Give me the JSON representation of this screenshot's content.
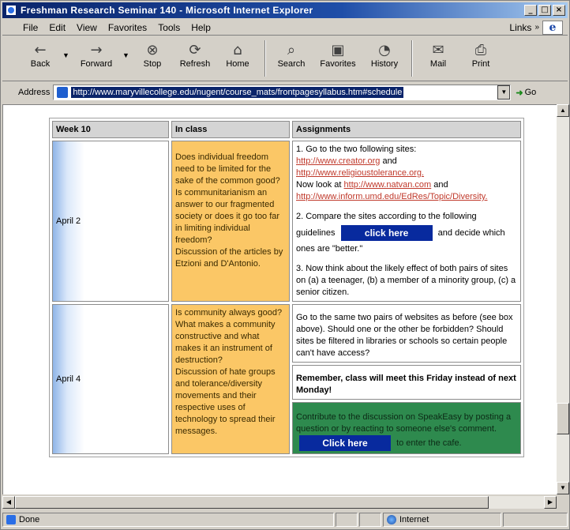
{
  "window": {
    "title": "Freshman Research Seminar 140 - Microsoft Internet Explorer",
    "controls": [
      "_",
      "□",
      "×"
    ]
  },
  "menu": {
    "items": [
      "File",
      "Edit",
      "View",
      "Favorites",
      "Tools",
      "Help"
    ],
    "links_label": "Links"
  },
  "toolbar": {
    "buttons": [
      {
        "label": "Back",
        "icon": "back-arrow-icon"
      },
      {
        "label": "Forward",
        "icon": "forward-arrow-icon"
      },
      {
        "label": "Stop",
        "icon": "stop-icon"
      },
      {
        "label": "Refresh",
        "icon": "refresh-icon"
      },
      {
        "label": "Home",
        "icon": "home-icon"
      },
      {
        "label": "Search",
        "icon": "search-icon"
      },
      {
        "label": "Favorites",
        "icon": "favorites-icon"
      },
      {
        "label": "History",
        "icon": "history-icon"
      },
      {
        "label": "Mail",
        "icon": "mail-icon"
      },
      {
        "label": "Print",
        "icon": "print-icon"
      }
    ]
  },
  "address": {
    "label": "Address",
    "url": "http://www.maryvillecollege.edu/nugent/course_mats/frontpagesyllabus.htm#schedule",
    "go_label": "Go"
  },
  "schedule": {
    "headers": {
      "week": "Week 10",
      "in_class": "In class",
      "assignments": "Assignments"
    },
    "row1": {
      "date": "April 2",
      "in_class": [
        "Does individual freedom need to be limited for the sake of the common good?",
        "Is communitarianism an answer to our fragmented society or does it go too far in limiting individual freedom?",
        "Discussion of the articles by Etzioni and D'Antonio."
      ],
      "step1_intro": "1.  Go to the two following sites:",
      "link1": "http://www.creator.org",
      "and1": " and",
      "link2": "http://www.religioustolerance.org.",
      "now_look": "Now look at ",
      "link3": "http://www.natvan.com",
      "and2": " and",
      "link4": "http://www.inform.umd.edu/EdRes/Topic/Diversity.",
      "step2_a": "2.  Compare the sites according to the following",
      "step2_b": "guidelines",
      "click_here_1": "click here",
      "step2_c": "and decide which ones are \"better.\"",
      "step3": "3.  Now think about the likely effect of both pairs of sites on (a) a teenager, (b) a member of a minority group, (c) a senior citizen."
    },
    "row2": {
      "date": "April 4",
      "in_class": [
        "Is community always good?",
        "What makes a community constructive and what makes it an instrument of destruction?",
        "Discussion of hate groups and tolerance/diversity movements and their respective uses of technology to spread their messages."
      ],
      "assignment": "Go to the same two pairs of websites as before (see box above).  Should one or the other be forbidden?  Should sites be filtered in libraries or schools so certain people can't have access?",
      "reminder": "Remember, class will meet this Friday instead of next Monday!",
      "speakeasy_a": "Contribute to the discussion on SpeakEasy by posting a question or by reacting to someone else's comment.",
      "click_here_2": "Click here",
      "speakeasy_b": "to enter the cafe."
    }
  },
  "status": {
    "text": "Done",
    "zone": "Internet"
  },
  "colors": {
    "titlebar": "#0a246a",
    "in_class_bg": "#fbc766",
    "button_bg": "#082a9e",
    "green_bg": "#2e8a4e",
    "link": "#c0392b"
  }
}
